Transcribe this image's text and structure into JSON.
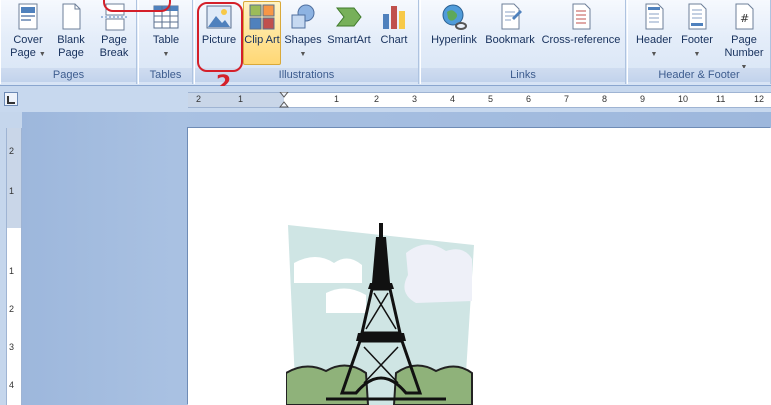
{
  "ribbon": {
    "groups": {
      "pages": {
        "label": "Pages",
        "buttons": [
          {
            "label": "Cover Page",
            "dropdown": true,
            "icon": "cover-page-icon"
          },
          {
            "label": "Blank Page",
            "icon": "blank-page-icon"
          },
          {
            "label": "Page Break",
            "icon": "page-break-icon"
          }
        ]
      },
      "tables": {
        "label": "Tables",
        "buttons": [
          {
            "label": "Table",
            "dropdown": true,
            "icon": "table-icon"
          }
        ]
      },
      "illustrations": {
        "label": "Illustrations",
        "buttons": [
          {
            "label": "Picture",
            "icon": "picture-icon"
          },
          {
            "label": "Clip Art",
            "icon": "clip-art-icon"
          },
          {
            "label": "Shapes",
            "dropdown": true,
            "icon": "shapes-icon"
          },
          {
            "label": "SmartArt",
            "icon": "smartart-icon"
          },
          {
            "label": "Chart",
            "icon": "chart-icon"
          }
        ]
      },
      "links": {
        "label": "Links",
        "buttons": [
          {
            "label": "Hyperlink",
            "icon": "hyperlink-icon"
          },
          {
            "label": "Bookmark",
            "icon": "bookmark-icon"
          },
          {
            "label": "Cross-reference",
            "icon": "cross-reference-icon"
          }
        ]
      },
      "header_footer": {
        "label": "Header & Footer",
        "buttons": [
          {
            "label": "Header",
            "dropdown": true,
            "icon": "header-icon"
          },
          {
            "label": "Footer",
            "dropdown": true,
            "icon": "footer-icon"
          },
          {
            "label": "Page Number",
            "dropdown": true,
            "icon": "page-number-icon"
          }
        ]
      }
    }
  },
  "annotations": {
    "step_label": "2",
    "highlight_color": "#d4202a"
  },
  "ruler": {
    "h_numbers": [
      "2",
      "1",
      "1",
      "2",
      "3",
      "4",
      "5",
      "6",
      "7",
      "8",
      "9",
      "10",
      "11",
      "12"
    ],
    "v_numbers": [
      "2",
      "1",
      "1",
      "2",
      "3",
      "4"
    ]
  },
  "document": {
    "image_alt": "Eiffel Tower clip art"
  }
}
